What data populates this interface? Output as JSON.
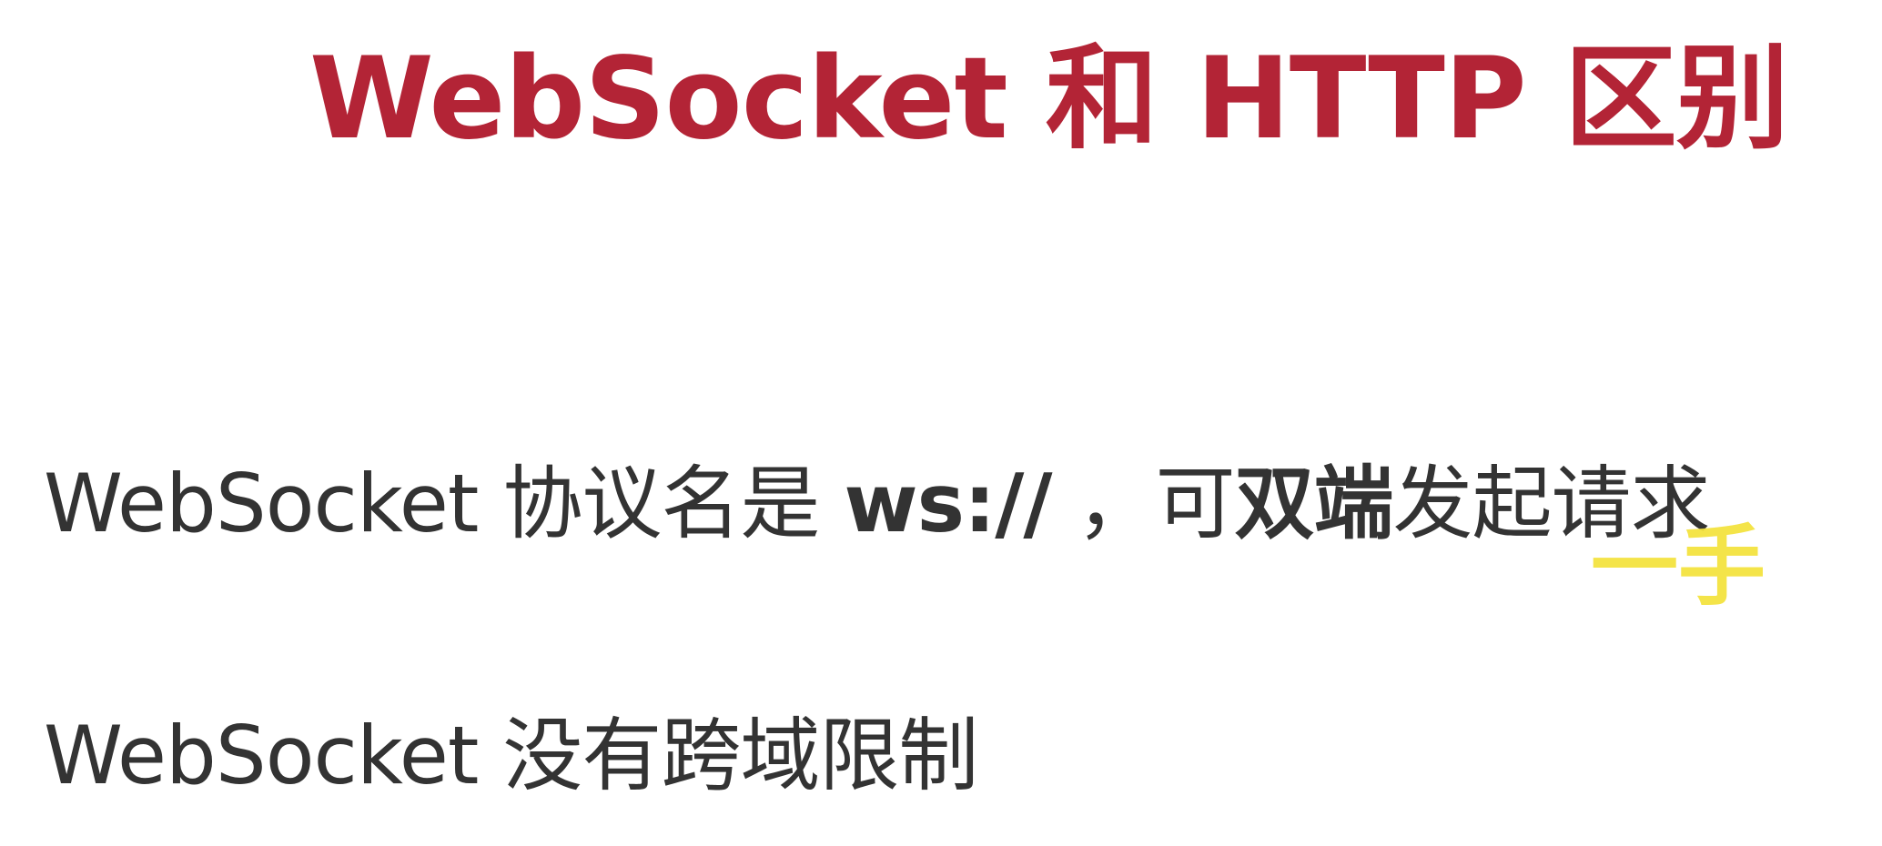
{
  "slide": {
    "title": "WebSocket 和 HTTP 区别",
    "bullets": [
      {
        "segments": [
          {
            "text": "WebSocket 协议名是 ",
            "bold": false
          },
          {
            "text": "ws://",
            "bold": true
          },
          {
            "text": " ，可",
            "bold": false
          },
          {
            "text": "双端",
            "bold": true
          },
          {
            "text": "发起请求",
            "bold": false
          }
        ]
      },
      {
        "segments": [
          {
            "text": "WebSocket 没有跨域限制",
            "bold": false
          }
        ]
      }
    ],
    "watermark": "一手"
  },
  "colors": {
    "title": "#b32436",
    "body_text": "#333333",
    "watermark": "#f4e23a",
    "background": "#ffffff"
  }
}
